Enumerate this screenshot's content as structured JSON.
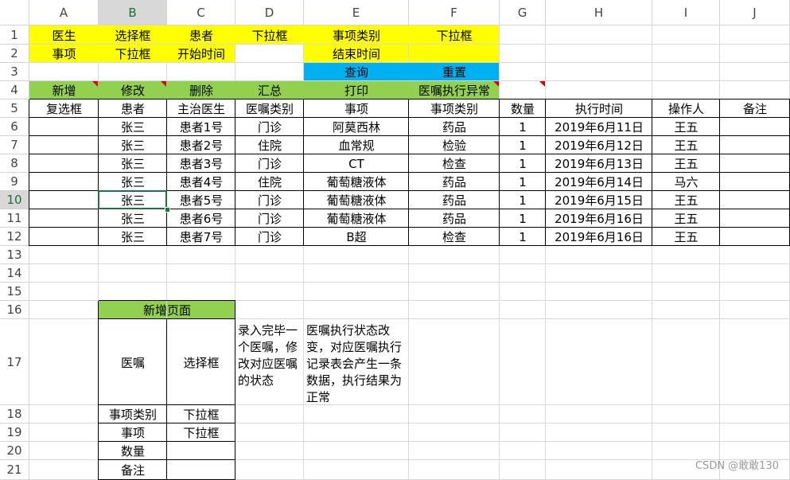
{
  "columns": [
    "A",
    "B",
    "C",
    "D",
    "E",
    "F",
    "G",
    "H",
    "I",
    "J"
  ],
  "selected_column": "B",
  "selected_row": "10",
  "row_numbers": [
    "1",
    "2",
    "3",
    "4",
    "5",
    "6",
    "7",
    "8",
    "9",
    "10",
    "11",
    "12",
    "13",
    "14",
    "15",
    "16",
    "17",
    "18",
    "19",
    "20",
    "21"
  ],
  "colors": {
    "yellow": "#ffff00",
    "blue": "#00b0f0",
    "green": "#92d050",
    "selection": "#1e7145",
    "grid": "#d8d8d8",
    "comment_marker": "#e00000"
  },
  "row1": {
    "A": "医生",
    "B": "选择框",
    "C": "患者",
    "D": "下拉框",
    "E": "事项类别",
    "F": "下拉框"
  },
  "row2": {
    "A": "事项",
    "B": "下拉框",
    "C": "开始时间",
    "E": "结束时间"
  },
  "row3": {
    "E": "查询",
    "F": "重置"
  },
  "row4": {
    "A": "新增",
    "B": "修改",
    "C": "删除",
    "D": "汇总",
    "E": "打印",
    "F": "医嘱执行异常"
  },
  "table": {
    "headers": [
      "复选框",
      "患者",
      "主治医生",
      "医嘱类别",
      "事项",
      "事项类别",
      "数量",
      "执行时间",
      "操作人",
      "备注"
    ],
    "rows": [
      [
        "",
        "张三",
        "患者1号",
        "门诊",
        "阿莫西林",
        "药品",
        "1",
        "2019年6月11日",
        "王五",
        ""
      ],
      [
        "",
        "张三",
        "患者2号",
        "住院",
        "血常规",
        "检验",
        "1",
        "2019年6月12日",
        "王五",
        ""
      ],
      [
        "",
        "张三",
        "患者3号",
        "门诊",
        "CT",
        "检查",
        "1",
        "2019年6月13日",
        "王五",
        ""
      ],
      [
        "",
        "张三",
        "患者4号",
        "住院",
        "葡萄糖液体",
        "药品",
        "1",
        "2019年6月14日",
        "马六",
        ""
      ],
      [
        "",
        "张三",
        "患者5号",
        "门诊",
        "葡萄糖液体",
        "药品",
        "1",
        "2019年6月15日",
        "王五",
        ""
      ],
      [
        "",
        "张三",
        "患者6号",
        "门诊",
        "葡萄糖液体",
        "药品",
        "1",
        "2019年6月16日",
        "王五",
        ""
      ],
      [
        "",
        "张三",
        "患者7号",
        "门诊",
        "B超",
        "检查",
        "1",
        "2019年6月16日",
        "王五",
        ""
      ]
    ]
  },
  "add_page": {
    "title": "新增页面",
    "rows": [
      [
        "医嘱",
        "选择框"
      ],
      [
        "事项类别",
        "下拉框"
      ],
      [
        "事项",
        "下拉框"
      ],
      [
        "数量",
        ""
      ],
      [
        "备注",
        ""
      ]
    ]
  },
  "notes": {
    "d17": "录入完毕一个医嘱，修改对应医嘱的状态",
    "e17": "医嘱执行状态改变，对应医嘱执行记录表会产生一条数据，执行结果为正常"
  },
  "watermark": "CSDN @敢敢130"
}
